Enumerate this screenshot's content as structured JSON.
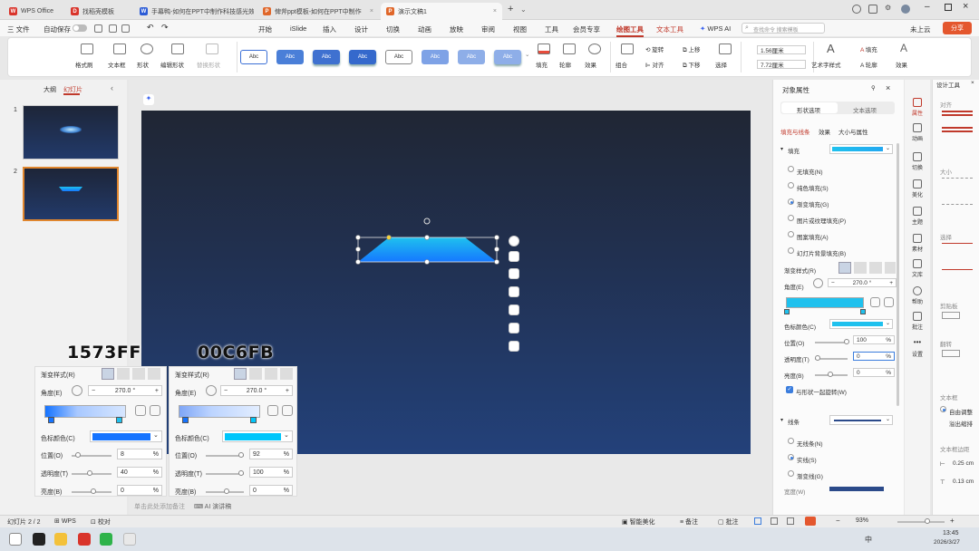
{
  "titlebar": {
    "tabs": [
      {
        "label": "WPS Office",
        "color": "#d9342b"
      },
      {
        "label": "找稻壳模板",
        "color": "#d9342b"
      },
      {
        "label": "手幕鸭-如何在PPT中制作科技感光效",
        "color": "#2b5bd6"
      },
      {
        "label": "俾斧ppt模板-如何在PPT中制作",
        "color": "#e0672a"
      },
      {
        "label": "演示文稿1",
        "color": "#e0672a"
      }
    ],
    "new_tab": "+"
  },
  "menu": {
    "file": "三 文件",
    "autosave": "自动保存",
    "items": [
      "开始",
      "iSlide",
      "插入",
      "设计",
      "切换",
      "动画",
      "放映",
      "审阅",
      "视图",
      "工具",
      "会员专享",
      "绘图工具",
      "文本工具",
      "WPS AI"
    ],
    "selected": "绘图工具",
    "search_placeholder": "查找命令 搜索模板",
    "cloud": "未上云",
    "share": "分享"
  },
  "ribbon": {
    "format_painter": "格式刷",
    "textbox": "文本框",
    "shape": "形状",
    "edit_shape": "编辑形状",
    "replace_shape": "替换形状",
    "styles": [
      "Abc",
      "Abc",
      "Abc",
      "Abc",
      "Abc",
      "Abc",
      "Abc",
      "Abc"
    ],
    "fill": "填充",
    "outline": "轮廓",
    "effect": "效果",
    "group": "组合",
    "align": "对齐",
    "rotate": "旋转",
    "up": "上移",
    "down": "下移",
    "select": "选择",
    "height": "1.56厘米",
    "width": "7.72厘米",
    "art_style": "艺术字样式",
    "text_fill": "填充",
    "text_outline": "轮廓",
    "text_effect": "效果"
  },
  "left_panel": {
    "tabs": [
      "大纲",
      "幻灯片"
    ],
    "selected_tab": "幻灯片",
    "slides": [
      "1",
      "2"
    ]
  },
  "float_toolbar": [
    "minus-icon",
    "layers-icon",
    "pen-icon",
    "fill-icon",
    "crop-icon",
    "image-icon",
    "ai-icon"
  ],
  "format_pane": {
    "title": "对象属性",
    "tabs": [
      "形状选项",
      "文本选项"
    ],
    "subtabs": [
      "填充与线条",
      "效果",
      "大小与属性"
    ],
    "fill_section": "填充",
    "fill_options": [
      "无填充(N)",
      "纯色填充(S)",
      "渐变填充(G)",
      "图片或纹理填充(P)",
      "图案填充(A)",
      "幻灯片背景填充(B)"
    ],
    "fill_selected": 2,
    "gradient_style": "渐变样式(R)",
    "angle_label": "角度(E)",
    "angle_value": "270.0 °",
    "stop_color_label": "色标颜色(C)",
    "position_label": "位置(O)",
    "position_value": "100",
    "transparency_label": "透明度(T)",
    "transparency_value": "0",
    "brightness_label": "亮度(B)",
    "brightness_value": "0",
    "percent": "%",
    "rotate_with_shape": "与形状一起旋转(W)",
    "line_section": "线条",
    "line_options": [
      "无线条(N)",
      "实线(S)",
      "渐变线(G)"
    ],
    "line_selected": 1,
    "width_label": "宽度(W)",
    "stop_color": "#1fc1ee"
  },
  "vertical_strip": [
    "属性",
    "动画",
    "切换",
    "美化",
    "主题",
    "素材",
    "文库",
    "帮助",
    "批注",
    "设置"
  ],
  "design_panel": {
    "title": "设计工具",
    "align": "对齐",
    "size": "大小",
    "select": "选择",
    "clipboard": "剪贴板",
    "flip": "翻转",
    "textbox": "文本框",
    "autofit": "自由调整",
    "overflow": "溢出缩排",
    "margin": "文本框边距",
    "margin_1": "0.25 cm",
    "margin_2": "0.13 cm"
  },
  "overlay_left": {
    "hex": "1573FF",
    "color": "#1573FF",
    "gradient_style": "渐变样式(R)",
    "angle_label": "角度(E)",
    "angle_value": "270.0 °",
    "stop_color_label": "色标颜色(C)",
    "position_label": "位置(O)",
    "position_value": "8",
    "transparency_label": "透明度(T)",
    "transparency_value": "40",
    "brightness_label": "亮度(B)",
    "brightness_value": "0",
    "percent": "%"
  },
  "overlay_right": {
    "hex": "00C6FB",
    "color": "#00C6FB",
    "gradient_style": "渐变样式(R)",
    "angle_label": "角度(E)",
    "angle_value": "270.0 °",
    "stop_color_label": "色标颜色(C)",
    "position_label": "位置(O)",
    "position_value": "92",
    "transparency_label": "透明度(T)",
    "transparency_value": "100",
    "brightness_label": "亮度(B)",
    "brightness_value": "0",
    "percent": "%"
  },
  "notes_placeholder": "单击此处添加备注",
  "ai_notes": "AI 演讲稿",
  "status": {
    "slide_count": "幻灯片 2 / 2",
    "wps": "WPS",
    "proofread": "校对",
    "smart_beautify": "智能美化",
    "notes": "备注",
    "comments": "批注",
    "zoom": "93%"
  },
  "taskbar": {
    "time": "13:45",
    "date": "2026/3/27",
    "ime": "中"
  },
  "colors": {
    "accent_red": "#c0392b",
    "slide_top": "#202634",
    "slide_bottom": "#23417a",
    "shape_top": "#1fc1ee",
    "shape_bottom": "#1577ff"
  }
}
